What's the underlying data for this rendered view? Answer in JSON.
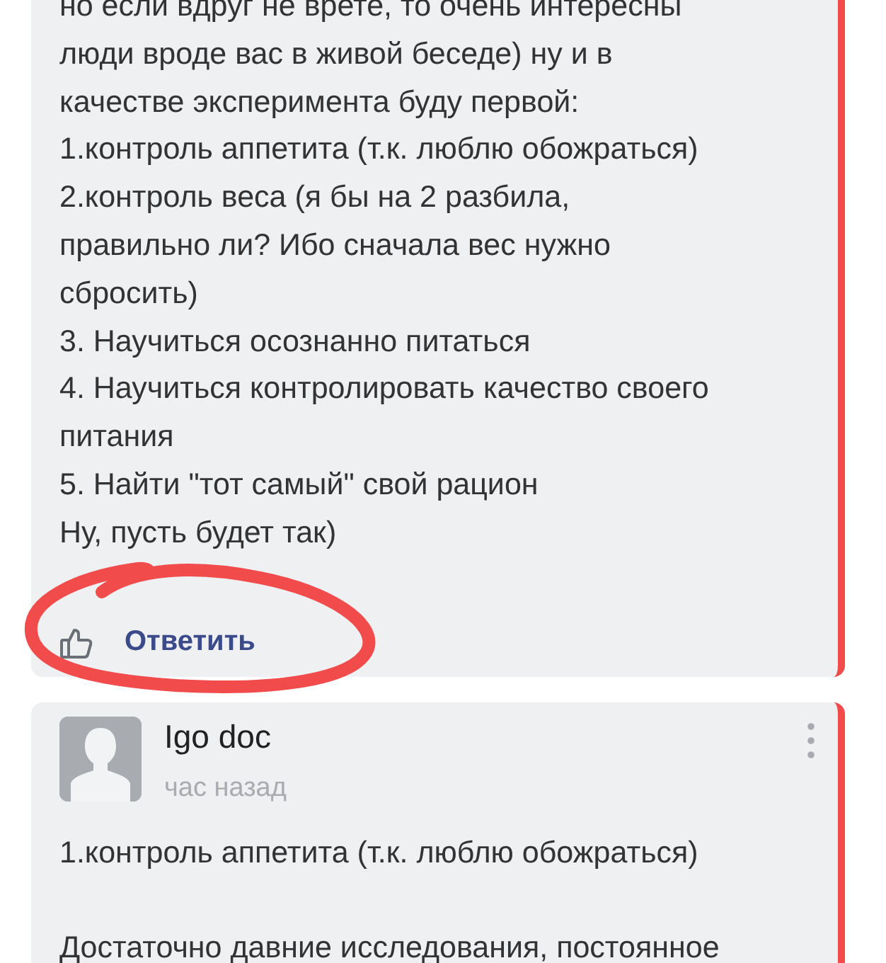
{
  "comments": [
    {
      "paragraphs": [
        [
          "но если вдруг не врете, то очень интересны",
          "люди вроде вас в живой беседе) ну и в",
          "качестве эксперимента буду первой:",
          "1.контроль аппетита (т.к. люблю обожраться)",
          "2.контроль веса (я бы на 2 разбила,",
          "правильно ли? Ибо сначала вес нужно",
          "сбросить)",
          "3. Научиться осознанно питаться",
          "4. Научиться контролировать качество своего",
          "питания",
          "5. Найти \"тот самый\" свой рацион",
          "Ну, пусть будет так)"
        ]
      ],
      "reply_label": "Ответить"
    },
    {
      "author": "Igo doc",
      "time": "час назад",
      "paragraphs": [
        [
          "1.контроль аппетита (т.к. люблю обожраться)"
        ],
        [
          "Достаточно давние исследования, постоянное"
        ]
      ]
    }
  ]
}
